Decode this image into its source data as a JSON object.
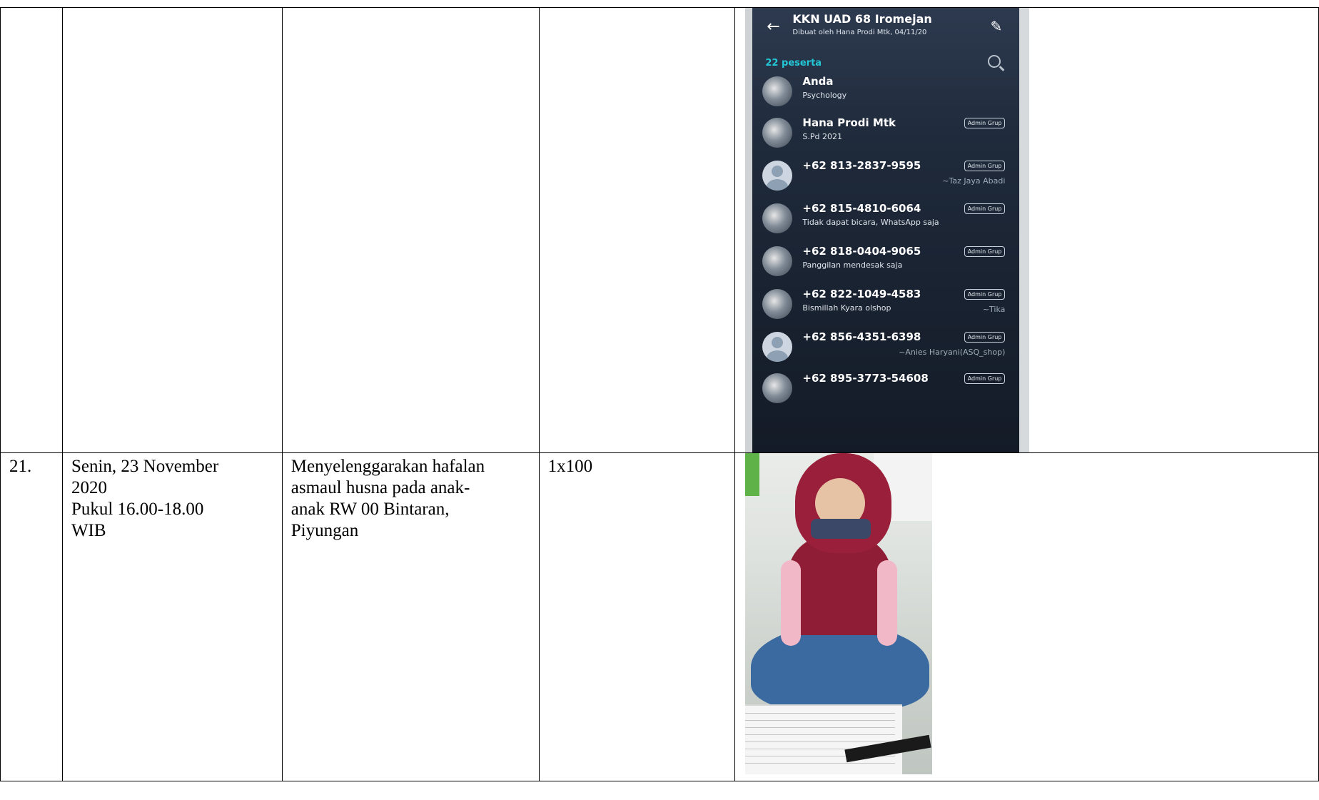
{
  "rows": [
    {
      "no": "",
      "date_lines": [],
      "activity_lines": [],
      "volume": "",
      "photo": {
        "kind": "phone-screenshot",
        "group_title": "KKN UAD 68 Iromejan",
        "group_subtitle": "Dibuat oleh Hana Prodi Mtk, 04/11/20",
        "participants_label": "22 peserta",
        "members": [
          {
            "name": "Anda",
            "about": "Psychology",
            "badge": "",
            "alias": ""
          },
          {
            "name": "Hana Prodi Mtk",
            "about": "S.Pd 2021",
            "badge": "Admin Grup",
            "alias": ""
          },
          {
            "name": "+62 813-2837-9595",
            "about": "",
            "badge": "Admin Grup",
            "alias": "~Taz Jaya Abadi"
          },
          {
            "name": "+62 815-4810-6064",
            "about": "Tidak dapat bicara, WhatsApp saja",
            "badge": "Admin Grup",
            "alias": ""
          },
          {
            "name": "+62 818-0404-9065",
            "about": "Panggilan mendesak saja",
            "badge": "Admin Grup",
            "alias": ""
          },
          {
            "name": "+62 822-1049-4583",
            "about": "Bismillah Kyara olshop",
            "badge": "Admin Grup",
            "alias": "~Tika"
          },
          {
            "name": "+62 856-4351-6398",
            "about": "",
            "badge": "Admin Grup",
            "alias": "~Anies Haryani(ASQ_shop)"
          },
          {
            "name": "+62 895-3773-54608",
            "about": "",
            "badge": "Admin Grup",
            "alias": ""
          }
        ]
      }
    },
    {
      "no": "21.",
      "date_lines": [
        "Senin, 23 November",
        "2020",
        "Pukul 16.00-18.00",
        "WIB"
      ],
      "activity_lines": [
        "Menyelenggarakan hafalan",
        "asmaul husna pada anak-",
        "anak RW 00 Bintaran,",
        "Piyungan"
      ],
      "volume": "1x100",
      "photo": {
        "kind": "photo-girl-reciting"
      }
    }
  ]
}
